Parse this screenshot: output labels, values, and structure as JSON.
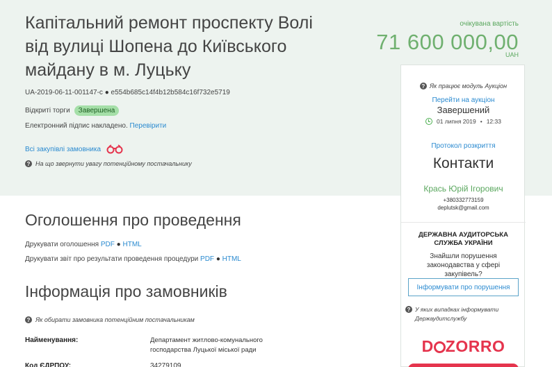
{
  "tender": {
    "title": "Капітальний ремонт проспекту Волі від вулиці Шопена до Київського майдану в м. Луцьку",
    "id": "UA-2019-06-11-001147-c",
    "hash": "e554b685c14f4b12b584c16f732e5719",
    "procedure": "Відкриті торги",
    "status_badge": "Завершена",
    "signature_text": "Електронний підпис накладено.",
    "signature_link": "Перевірити",
    "all_purchases_link": "Всі закупівлі замовника",
    "hint_supplier": "На що звернути увагу потенційному постачальнику"
  },
  "price": {
    "label": "очікувана вартість",
    "value": "71 600 000,00",
    "currency": "UAH"
  },
  "side_card": {
    "auction_help": "Як працює модуль Аукціон",
    "go_to_auction": "Перейти на аукціон",
    "auction_status": "Завершений",
    "auction_date": "01 липня 2019",
    "auction_time": "12:33",
    "protocol_link": "Протокол розкриття",
    "contacts_title": "Контакти",
    "contact_person": "Крась Юрій Ігорович",
    "contact_phone": "+380332773159",
    "contact_email": "deplutsk@gmail.com",
    "audit_title": "ДЕРЖАВНА АУДИТОРСЬКА СЛУЖБА УКРАЇНИ",
    "audit_found": "Знайшли порушення законодавства у сфері закупівель?",
    "inform_button": "Інформувати про порушення",
    "when_inform": "У яких випадках інформувати Держаудитслужбу",
    "logo_text_pre": "D",
    "logo_text_post": "ZORRO",
    "accent_color": "#e5344d"
  },
  "announcement": {
    "title": "Оголошення про проведення",
    "print_announcement": "Друкувати оголошення",
    "print_report": "Друкувати звіт про результати проведення процедури",
    "pdf": "PDF",
    "html": "HTML"
  },
  "customer_info": {
    "title": "Інформація про замовників",
    "hint": "Як обирати замовника потенційним постачальникам",
    "name_label": "Найменування:",
    "name_value": "Департамент житлово-комунального господарства Луцької міської ради",
    "edrpou_label": "Код ЄДРПОУ:",
    "edrpou_value": "34279109"
  }
}
